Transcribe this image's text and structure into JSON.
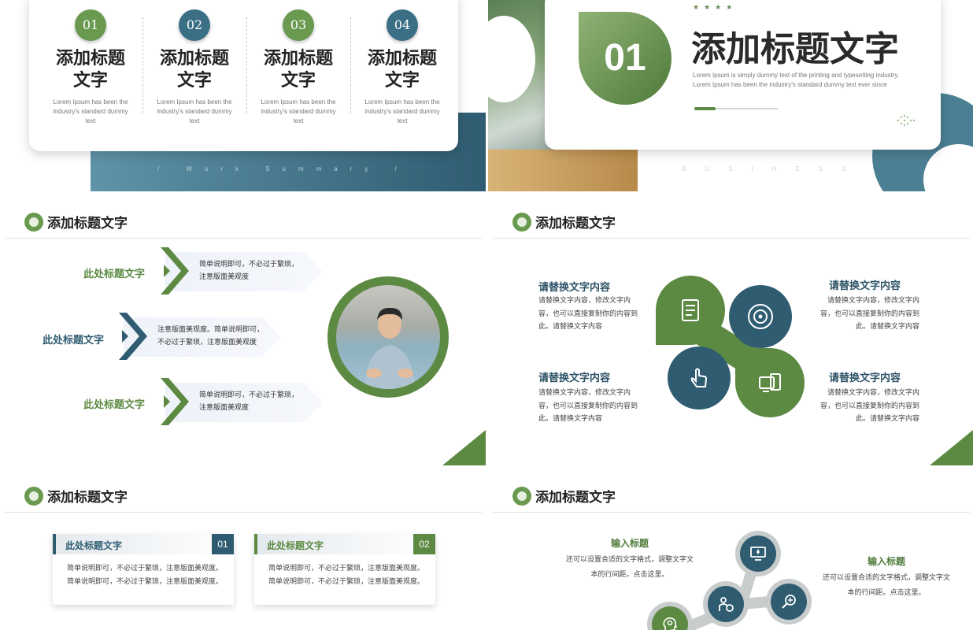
{
  "panel1": {
    "columns": [
      {
        "num": "01",
        "title": "添加标题文字",
        "desc": "Lorem Ipsum has been the industry's standard dummy text"
      },
      {
        "num": "02",
        "title": "添加标题文字",
        "desc": "Lorem Ipsum has been the industry's standard dummy text"
      },
      {
        "num": "03",
        "title": "添加标题文字",
        "desc": "Lorem Ipsum has been the industry's standard dummy text"
      },
      {
        "num": "04",
        "title": "添加标题文字",
        "desc": "Lorem Ipsum has been the industry's standard dummy text"
      }
    ],
    "tagline": "/ Work Summary /",
    "colors": {
      "green": "#6a9a4f",
      "blue": "#3a6f86"
    }
  },
  "panel2": {
    "badge": "01",
    "stars": "★★★★",
    "title": "添加标题文字",
    "lorem1": "Lorem Ipsum is simply dummy text of the printing and typesetting industry.",
    "lorem2": "Lorem Ipsum has been the industry's standard dummy text ever since",
    "progress": 0.25,
    "watermark": "BUSINESS"
  },
  "panel3": {
    "header": "添加标题文字",
    "rows": [
      {
        "label": "此处标题文字",
        "line1": "简单说明即可，不必过于繁琐，",
        "line2": "注意版面美观度",
        "color": "#5c8a42"
      },
      {
        "label": "此处标题文字",
        "line1": "注意版面美观度。简单说明即可，",
        "line2": "不必过于繁琐，注意版面美观度",
        "color": "#2f5c71"
      },
      {
        "label": "此处标题文字",
        "line1": "简单说明即可，不必过于繁琐，",
        "line2": "注意版面美观度",
        "color": "#5c8a42"
      }
    ]
  },
  "panel4": {
    "header": "添加标题文字",
    "items": [
      {
        "title": "请替换文字内容",
        "desc": "请替换文字内容，修改文字内容，也可以直接复制你的内容到此。请替换文字内容"
      },
      {
        "title": "请替换文字内容",
        "desc": "请替换文字内容，修改文字内容，也可以直接复制你的内容到此。请替换文字内容"
      },
      {
        "title": "请替换文字内容",
        "desc": "请替换文字内容，修改文字内容，也可以直接复制你的内容到此。请替换文字内容"
      },
      {
        "title": "请替换文字内容",
        "desc": "请替换文字内容，修改文字内容，也可以直接复制你的内容到此。请替换文字内容"
      }
    ],
    "icons": [
      "document-icon",
      "target-icon",
      "touch-icon",
      "devices-icon"
    ]
  },
  "panel5": {
    "header": "添加标题文字",
    "cards": [
      {
        "title": "此处标题文字",
        "num": "01",
        "desc": "简单说明即可，不必过于繁琐，注意版面美观度。简单说明即可，不必过于繁琐，注意版面美观度。",
        "color": "#2f5c71"
      },
      {
        "title": "此处标题文字",
        "num": "02",
        "desc": "简单说明即可，不必过于繁琐，注意版面美观度。简单说明即可，不必过于繁琐，注意版面美观度。",
        "color": "#5c8a42"
      }
    ]
  },
  "panel6": {
    "header": "添加标题文字",
    "items": [
      {
        "title": "输入标题",
        "line1": "还可以设置合适的文字格式，调整文字文",
        "line2": "本的行间距。点击这里。"
      },
      {
        "title": "输入标题",
        "line1": "还可以设置合适的文字格式，调整文字文",
        "line2": "本的行间距。点击这里。"
      }
    ],
    "icons": [
      "monitor-icon",
      "user-chart-icon",
      "search-icon",
      "head-gear-icon"
    ]
  }
}
